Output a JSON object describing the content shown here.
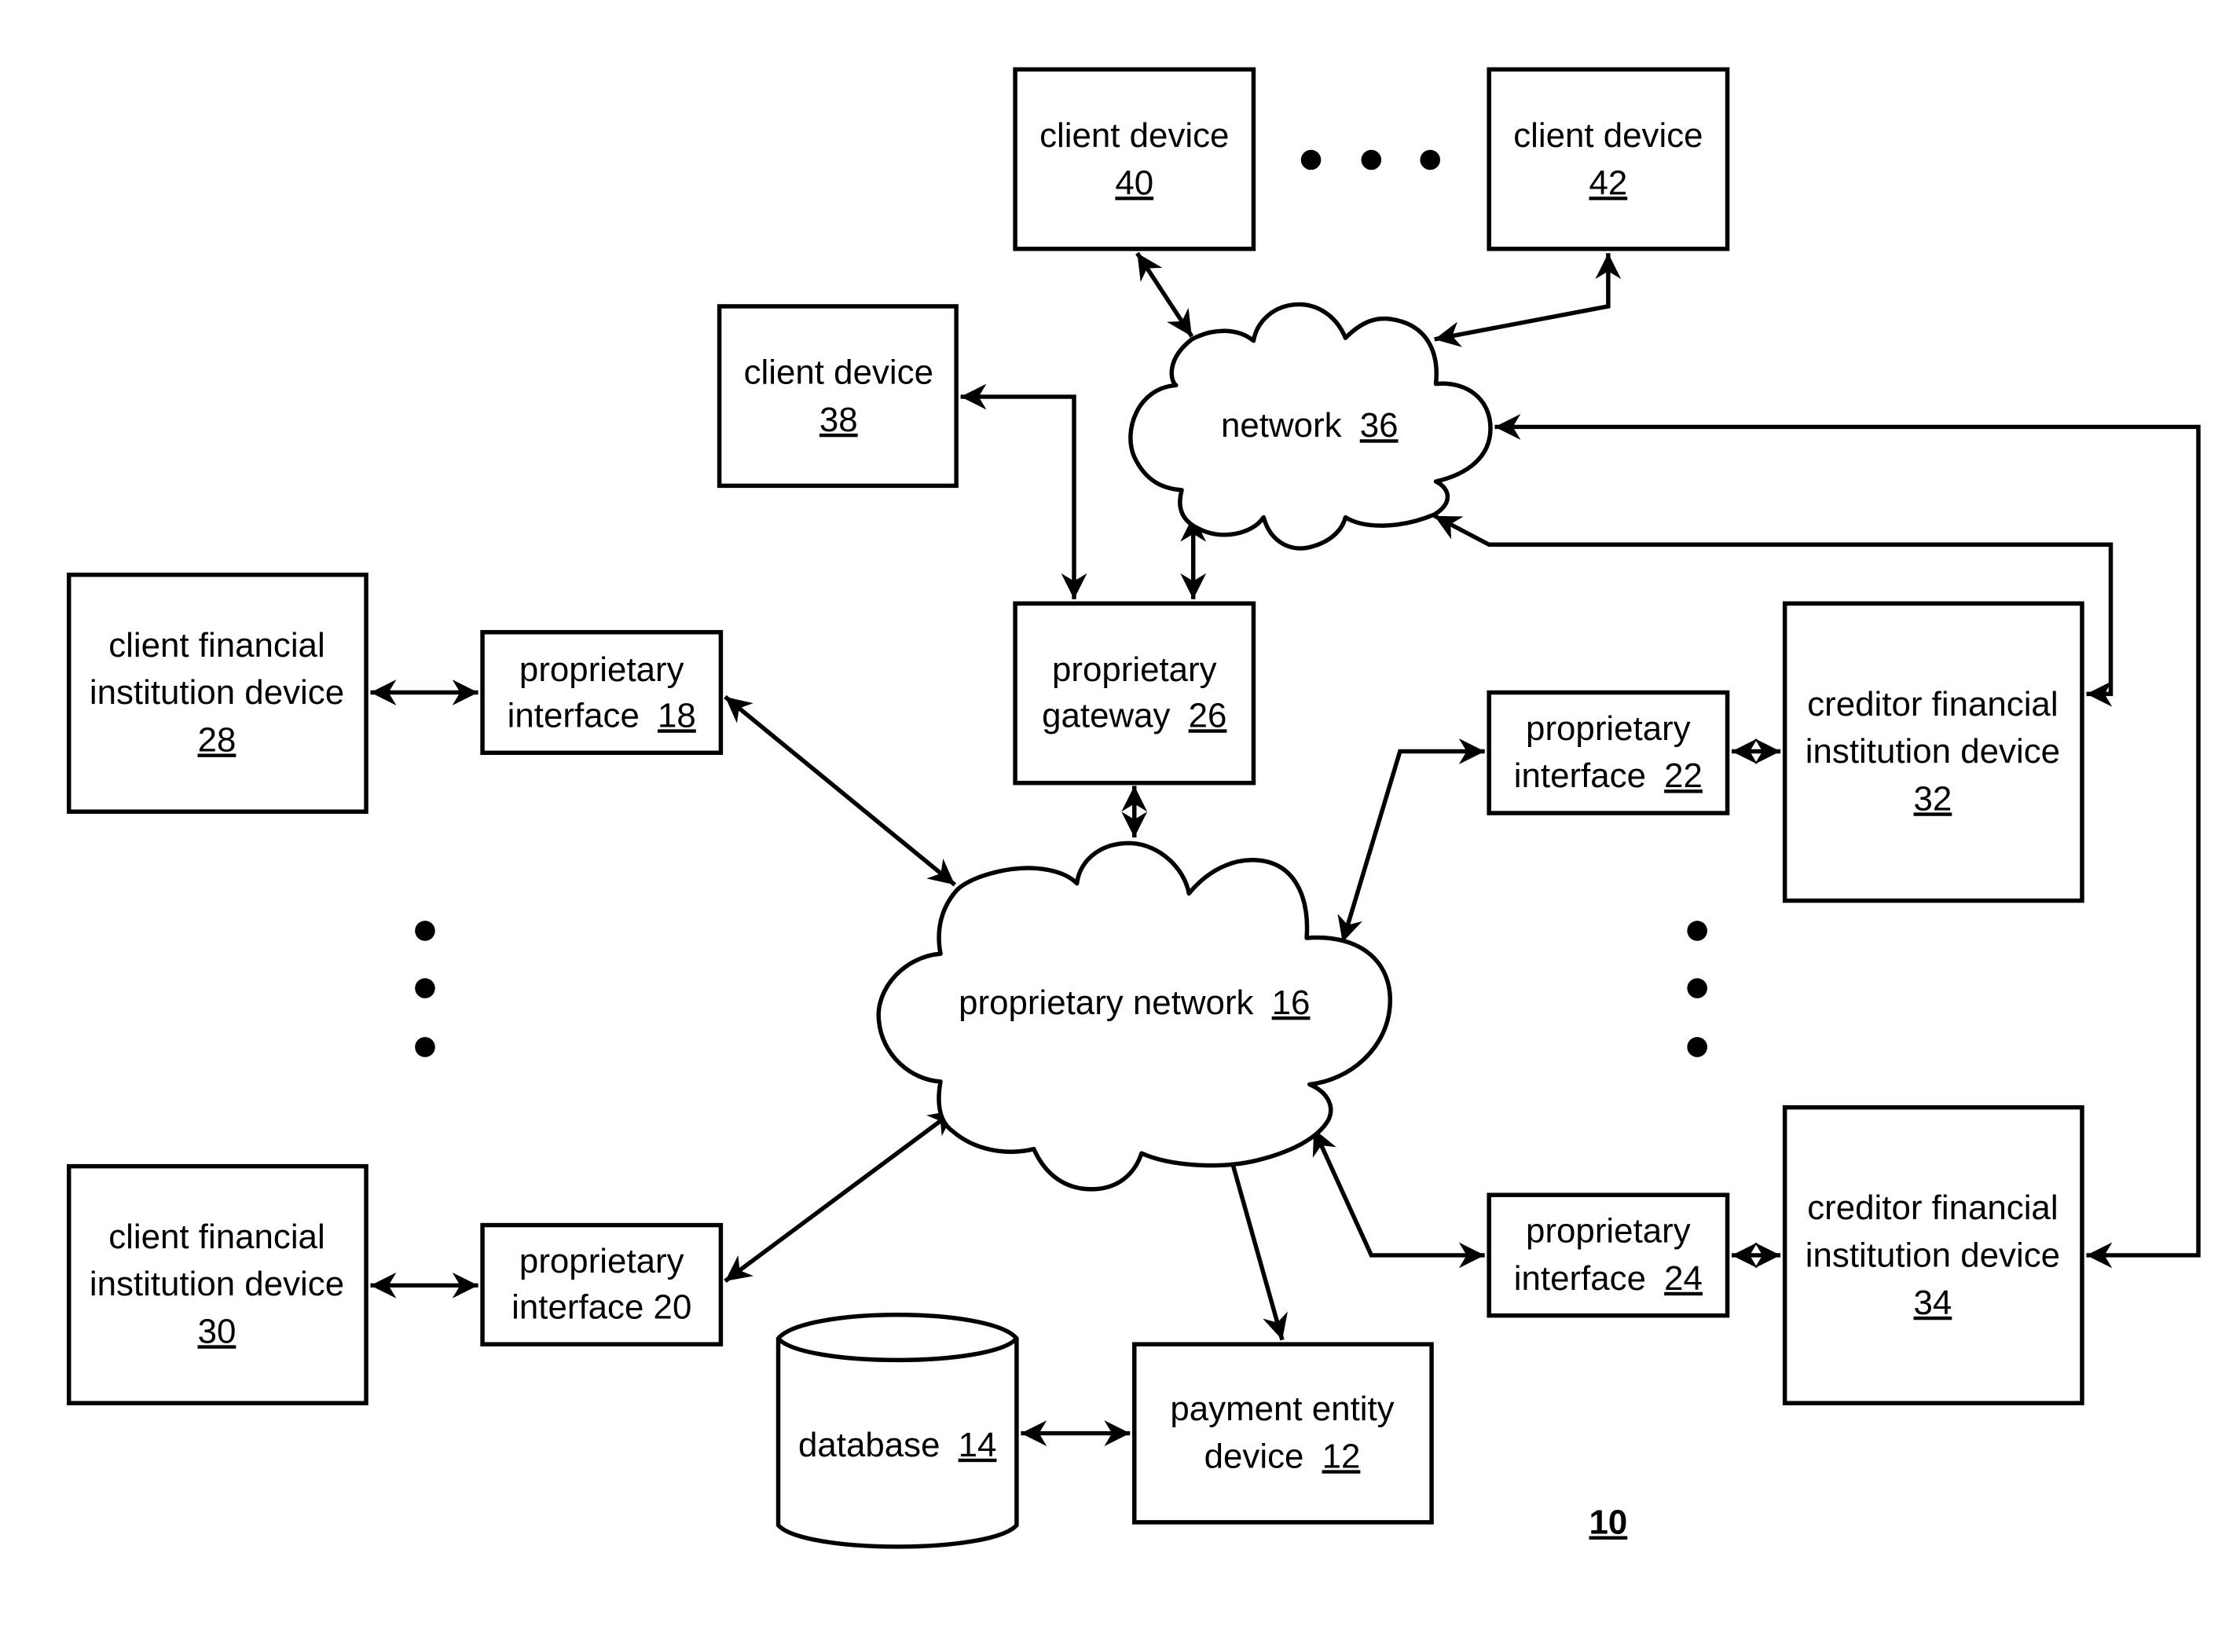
{
  "diagram": {
    "figure_label": "10",
    "nodes": {
      "client_device_40": {
        "line1": "client device",
        "ref": "40"
      },
      "client_device_42": {
        "line1": "client device",
        "ref": "42"
      },
      "client_device_38": {
        "line1": "client device",
        "ref": "38"
      },
      "network_36": {
        "text": "network",
        "ref": "36"
      },
      "client_fi_28": {
        "line1": "client financial",
        "line2": "institution device",
        "ref": "28"
      },
      "interface_18": {
        "line1": "proprietary",
        "line2": "interface",
        "ref": "18"
      },
      "gateway_26": {
        "line1": "proprietary",
        "line2": "gateway",
        "ref": "26"
      },
      "interface_22": {
        "line1": "proprietary",
        "line2": "interface",
        "ref": "22"
      },
      "creditor_fi_32": {
        "line1": "creditor financial",
        "line2": "institution device",
        "ref": "32"
      },
      "proprietary_network_16": {
        "text": "proprietary network",
        "ref": "16"
      },
      "client_fi_30": {
        "line1": "client financial",
        "line2": "institution device",
        "ref": "30"
      },
      "interface_20": {
        "line1": "proprietary",
        "line2": "interface 20"
      },
      "database_14": {
        "text": "database",
        "ref": "14"
      },
      "payment_entity_12": {
        "line1": "payment entity",
        "line2": "device",
        "ref": "12"
      },
      "interface_24": {
        "line1": "proprietary",
        "line2": "interface",
        "ref": "24"
      },
      "creditor_fi_34": {
        "line1": "creditor financial",
        "line2": "institution device",
        "ref": "34"
      }
    },
    "connections": [
      {
        "from": "client_device_40",
        "to": "network_36",
        "direction": "bidirectional"
      },
      {
        "from": "client_device_42",
        "to": "network_36",
        "direction": "bidirectional"
      },
      {
        "from": "client_device_38",
        "to": "gateway_26",
        "direction": "bidirectional"
      },
      {
        "from": "network_36",
        "to": "gateway_26",
        "direction": "bidirectional"
      },
      {
        "from": "creditor_fi_32",
        "to": "network_36",
        "direction": "bidirectional"
      },
      {
        "from": "creditor_fi_34",
        "to": "network_36",
        "direction": "bidirectional"
      },
      {
        "from": "client_fi_28",
        "to": "interface_18",
        "direction": "bidirectional"
      },
      {
        "from": "interface_18",
        "to": "proprietary_network_16",
        "direction": "bidirectional"
      },
      {
        "from": "gateway_26",
        "to": "proprietary_network_16",
        "direction": "bidirectional"
      },
      {
        "from": "proprietary_network_16",
        "to": "interface_22",
        "direction": "bidirectional"
      },
      {
        "from": "interface_22",
        "to": "creditor_fi_32",
        "direction": "bidirectional"
      },
      {
        "from": "client_fi_30",
        "to": "interface_20",
        "direction": "bidirectional"
      },
      {
        "from": "interface_20",
        "to": "proprietary_network_16",
        "direction": "bidirectional"
      },
      {
        "from": "proprietary_network_16",
        "to": "payment_entity_12",
        "direction": "bidirectional"
      },
      {
        "from": "proprietary_network_16",
        "to": "interface_24",
        "direction": "bidirectional"
      },
      {
        "from": "interface_24",
        "to": "creditor_fi_34",
        "direction": "bidirectional"
      },
      {
        "from": "database_14",
        "to": "payment_entity_12",
        "direction": "bidirectional"
      }
    ]
  }
}
